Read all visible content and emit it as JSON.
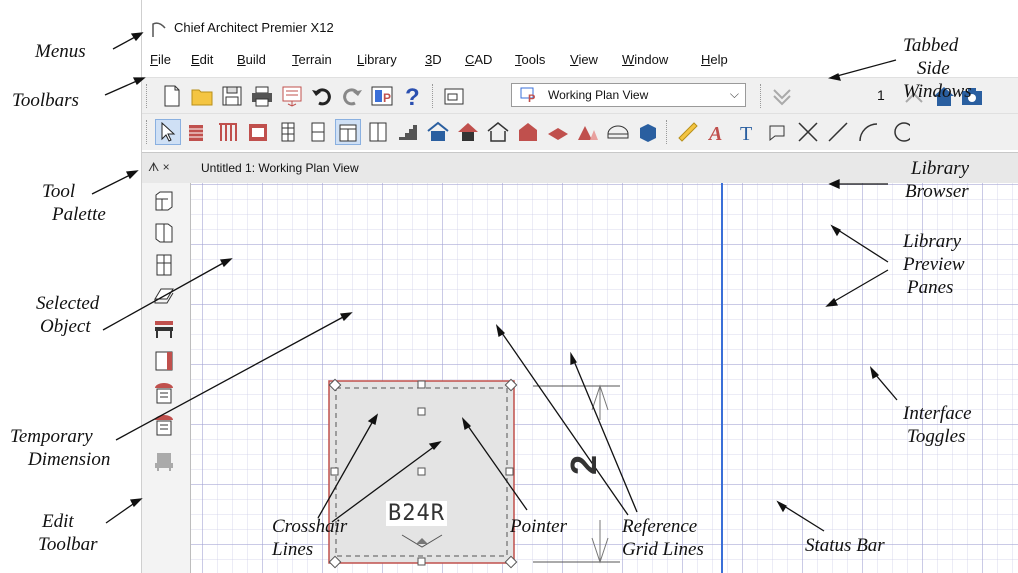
{
  "window": {
    "title": "Chief Architect Premier X12"
  },
  "menus": [
    "File",
    "Edit",
    "Build",
    "Terrain",
    "Library",
    "3D",
    "CAD",
    "Tools",
    "View",
    "Window",
    "Help"
  ],
  "toolbar": {
    "view_select": "Working Plan View",
    "floor_number": "1"
  },
  "tab": {
    "title": "Untitled 1:  Working Plan View",
    "palette_buttons": "ᗑ ×"
  },
  "canvas": {
    "object_label": "B24R",
    "dimension_text": "2"
  },
  "annotations": {
    "menus": "Menus",
    "toolbars": "Toolbars",
    "tool_palette": [
      "Tool",
      "Palette"
    ],
    "selected_object": [
      "Selected",
      "Object"
    ],
    "temporary_dimension": [
      "Temporary",
      "Dimension"
    ],
    "edit_toolbar": [
      "Edit",
      "Toolbar"
    ],
    "crosshair_lines": [
      "Crosshair",
      "Lines"
    ],
    "pointer": "Pointer",
    "reference_grid_lines": [
      "Reference",
      "Grid Lines"
    ],
    "status_bar": "Status Bar",
    "tabbed_side_windows": [
      "Tabbed",
      "Side",
      "Windows"
    ],
    "library_browser": [
      "Library",
      "Browser"
    ],
    "library_preview_panes": [
      "Library",
      "Preview",
      "Panes"
    ],
    "interface_toggles": [
      "Interface",
      "Toggles"
    ]
  },
  "colors": {
    "accent_blue": "#3a6fd8",
    "selection_red": "#c0504d",
    "object_fill": "#e4e4e4"
  }
}
